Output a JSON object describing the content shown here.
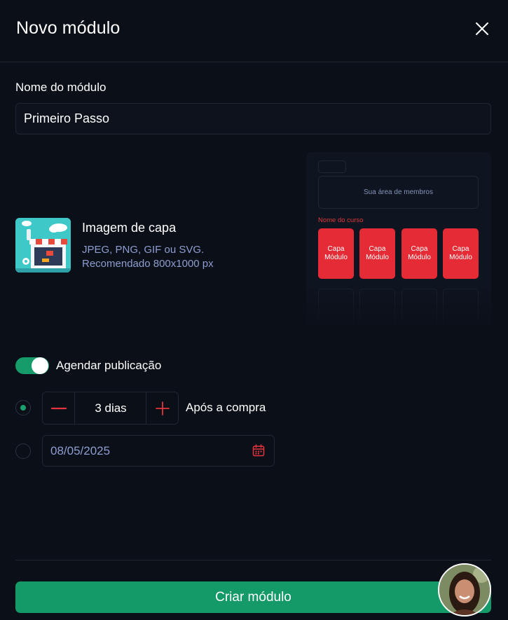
{
  "header": {
    "title": "Novo módulo",
    "close_icon": "close-icon"
  },
  "module_name": {
    "label": "Nome do módulo",
    "value": "Primeiro Passo"
  },
  "cover": {
    "title": "Imagem de capa",
    "hint_formats": "JPEG, PNG, GIF ou SVG.",
    "hint_size": "Recomendado 800x1000 px",
    "thumbnail_icon": "storefront-illustration"
  },
  "preview": {
    "banner_text": "Sua área de membros",
    "course_name": "Nome do curso",
    "cards": [
      {
        "line1": "Capa",
        "line2": "Módulo"
      },
      {
        "line1": "Capa",
        "line2": "Módulo"
      },
      {
        "line1": "Capa",
        "line2": "Módulo"
      },
      {
        "line1": "Capa",
        "line2": "Módulo"
      }
    ]
  },
  "schedule": {
    "toggle_label": "Agendar publicação",
    "toggle_on": true,
    "option_after_purchase": {
      "selected": true,
      "value": "3 dias",
      "label": "Após a compra"
    },
    "option_date": {
      "selected": false,
      "value": "08/05/2025",
      "icon": "calendar-icon"
    }
  },
  "footer": {
    "submit_label": "Criar módulo"
  },
  "colors": {
    "background": "#0b0f18",
    "primary_green": "#139a68",
    "accent_red": "#e52b35",
    "muted_text": "#8e9ed0"
  }
}
